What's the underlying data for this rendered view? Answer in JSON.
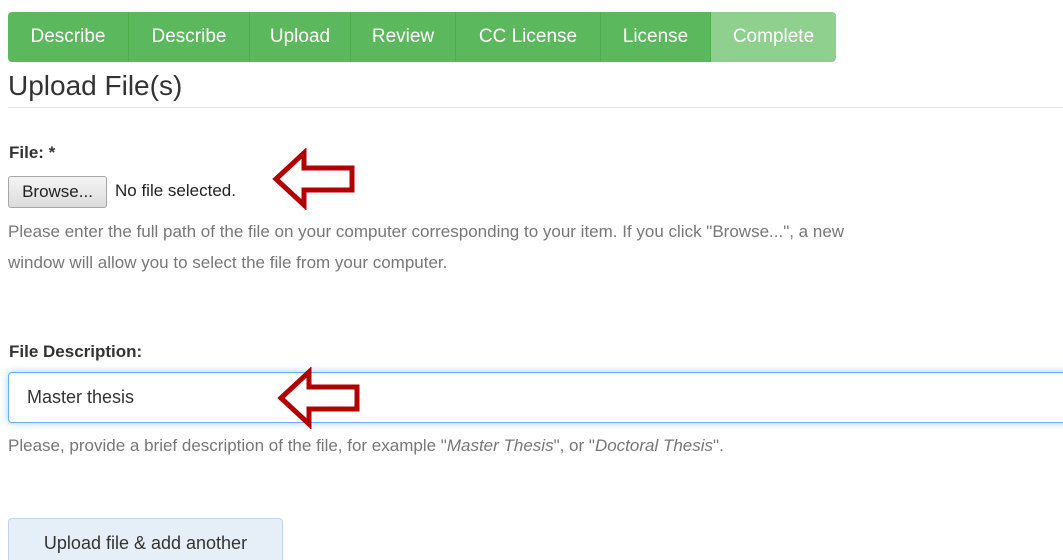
{
  "progress": {
    "steps": [
      {
        "label": "Describe"
      },
      {
        "label": "Describe"
      },
      {
        "label": "Upload"
      },
      {
        "label": "Review"
      },
      {
        "label": "CC License"
      },
      {
        "label": "License"
      },
      {
        "label": "Complete"
      }
    ],
    "current_step": "Complete"
  },
  "page": {
    "title": "Upload File(s)"
  },
  "file_field": {
    "label": "File: *",
    "browse_label": "Browse...",
    "status": "No file selected.",
    "help_line1": "Please enter the full path of the file on your computer corresponding to your item. If you click \"Browse...\", a new",
    "help_line2": "window will allow you to select the file from your computer."
  },
  "description_field": {
    "label": "File Description:",
    "value": "Master thesis",
    "help_prefix": "Please, provide a brief description of the file, for example \"",
    "help_example1": "Master Thesis",
    "help_middle": "\", or \"",
    "help_example2": "Doctoral Thesis",
    "help_suffix": "\"."
  },
  "actions": {
    "upload_another_label": "Upload file & add another"
  },
  "colors": {
    "step_active": "#5cb85c",
    "step_current": "#8fd08f",
    "annotation_arrow": "#b30000"
  },
  "annotations": [
    {
      "icon": "left-arrow-icon",
      "target": "file-status"
    },
    {
      "icon": "left-arrow-icon",
      "target": "description-input"
    }
  ]
}
